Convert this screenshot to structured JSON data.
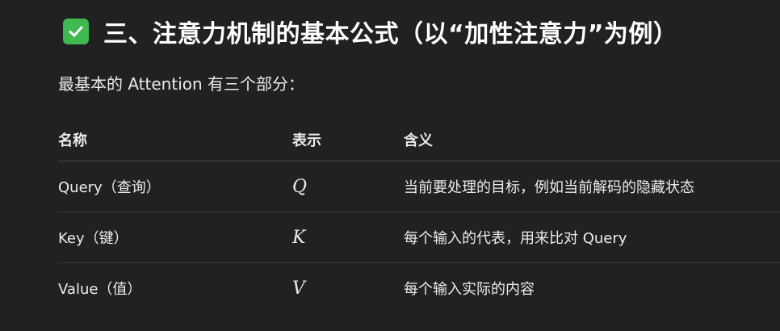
{
  "section": {
    "icon": "check-box-icon",
    "title": "三、注意力机制的基本公式（以“加性注意力”为例）",
    "intro": "最基本的 Attention 有三个部分："
  },
  "table": {
    "headers": [
      "名称",
      "表示",
      "含义"
    ],
    "rows": [
      {
        "name": "Query（查询）",
        "symbol": "Q",
        "meaning": "当前要处理的目标，例如当前解码的隐藏状态"
      },
      {
        "name": "Key（键）",
        "symbol": "K",
        "meaning": "每个输入的代表，用来比对 Query"
      },
      {
        "name": "Value（值）",
        "symbol": "V",
        "meaning": "每个输入实际的内容"
      }
    ]
  },
  "colors": {
    "background": "#212121",
    "check_icon": "#3fb950",
    "text": "#ececec"
  }
}
